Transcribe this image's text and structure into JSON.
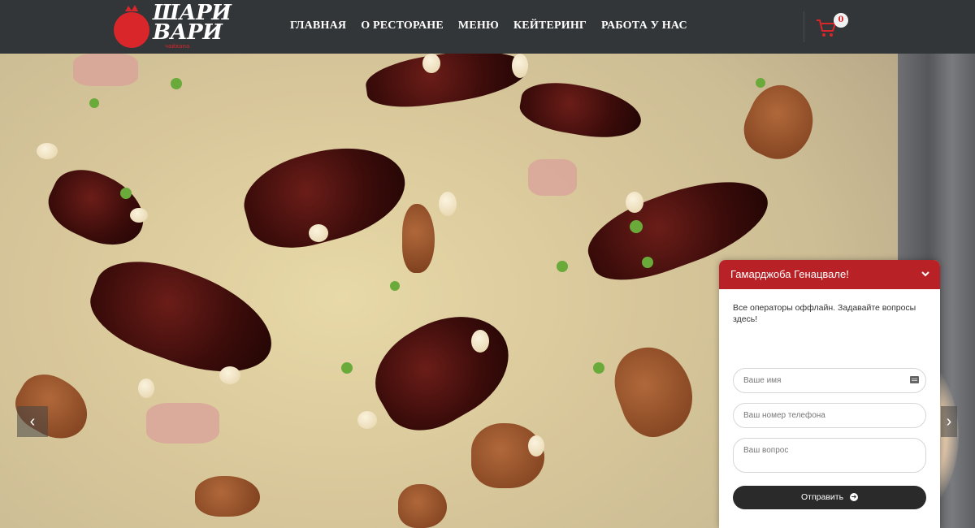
{
  "brand": {
    "logo_line1": "ШАРИ",
    "logo_line2": "ВАРИ",
    "logo_sub": "чайхана",
    "accent": "#d9262a"
  },
  "nav": {
    "items": [
      "ГЛАВНАЯ",
      "О РЕСТОРАНЕ",
      "МЕНЮ",
      "КЕЙТЕРИНГ",
      "РАБОТА У НАС"
    ]
  },
  "cart": {
    "count": "0",
    "icon": "cart-icon"
  },
  "hero": {
    "prev_icon": "chevron-left-icon",
    "next_icon": "chevron-right-icon"
  },
  "chat": {
    "title": "Гамарджоба Генацвале!",
    "message": "Все операторы оффлайн. Задавайте вопросы здесь!",
    "name_placeholder": "Ваше имя",
    "phone_placeholder": "Ваш номер телефона",
    "question_placeholder": "Ваш вопрос",
    "send_label": "Отправить",
    "header_color": "#b82227"
  }
}
